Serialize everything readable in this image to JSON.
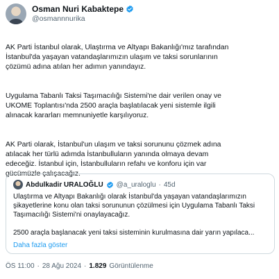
{
  "author": {
    "name": "Osman Nuri Kabaktepe",
    "handle": "@osmannnurika"
  },
  "post": {
    "paragraphs": [
      "AK Parti İstanbul olarak, Ulaştırma ve Altyapı Bakanlığı'mız tarafından\nİstanbul'da yaşayan vatandaşlarımızın ulaşım ve taksi sorunlarının\nçözümü adına atılan her adımın yanındayız.",
      "Uygulama Tabanlı Taksi Taşımacılığı Sistemi'ne dair verilen onay ve\nUKOME Toplantısı'nda 2500 araçla başlatılacak yeni sistemle ilgili\nalınacak kararları memnuniyetle karşılıyoruz.",
      "AK Parti olarak, İstanbul'un ulaşım ve taksi sorununu çözmek adına\natılacak her türlü adımda İstanbulluların yanında olmaya devam\nedeceğiz. İstanbul için, İstanbulluların refahı ve konforu için var\ngücümüzle çalışacağız."
    ]
  },
  "quote": {
    "name": "Abdulkadir URALOĞLU",
    "handle": "@a_uraloglu",
    "separator": "·",
    "age": "45d",
    "paragraph1": "Ulaştırma ve Altyapı Bakanlığı olarak İstanbul'da yaşayan vatandaşlarımızın şikayetlerine konu olan taksi sorununun çözülmesi için Uygulama Tabanlı Taksi Taşımacılığı Sistemi'ni onaylayacağız.",
    "paragraph2": "2500 araçla başlanacak yeni taksi sisteminin kurulmasına dair yarın yapılaca...",
    "show_more": "Daha fazla göster"
  },
  "footer": {
    "time": "ÖS 11:00",
    "dot1": "·",
    "date": "28 Ağu 2024",
    "dot2": "·",
    "views": "1.829",
    "views_label": "Görüntülenme"
  },
  "colors": {
    "verified": "#1d9bf0",
    "link": "#1d9bf0",
    "muted": "#536471"
  }
}
